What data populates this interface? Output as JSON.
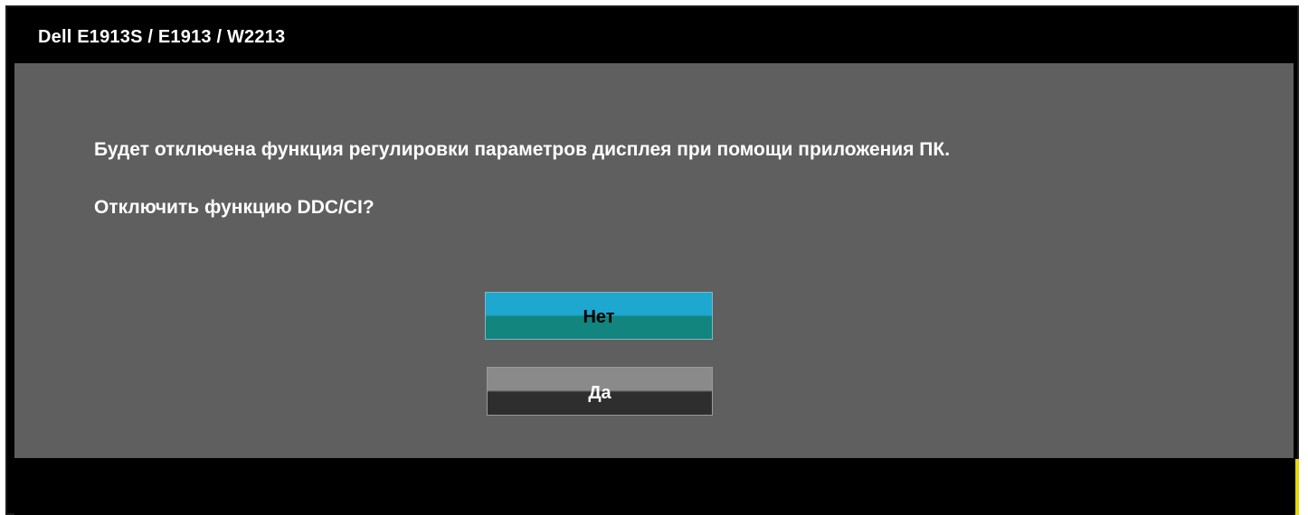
{
  "window": {
    "title": "Dell E1913S / E1913 / W2213"
  },
  "dialog": {
    "message_line1": "Будет отключена функция регулировки параметров дисплея при помощи приложения ПК.",
    "message_line2": "Отключить функцию DDC/CI?"
  },
  "buttons": {
    "no_label": "Нет",
    "yes_label": "Да"
  },
  "colors": {
    "title_bar": "#000000",
    "panel": "#5f5f5f",
    "selected_button_top": "#1ea7cf",
    "selected_button_bottom": "#12857e",
    "button_top": "#8a8a8a",
    "button_bottom": "#2e2e2e",
    "accent": "#e6d800"
  }
}
